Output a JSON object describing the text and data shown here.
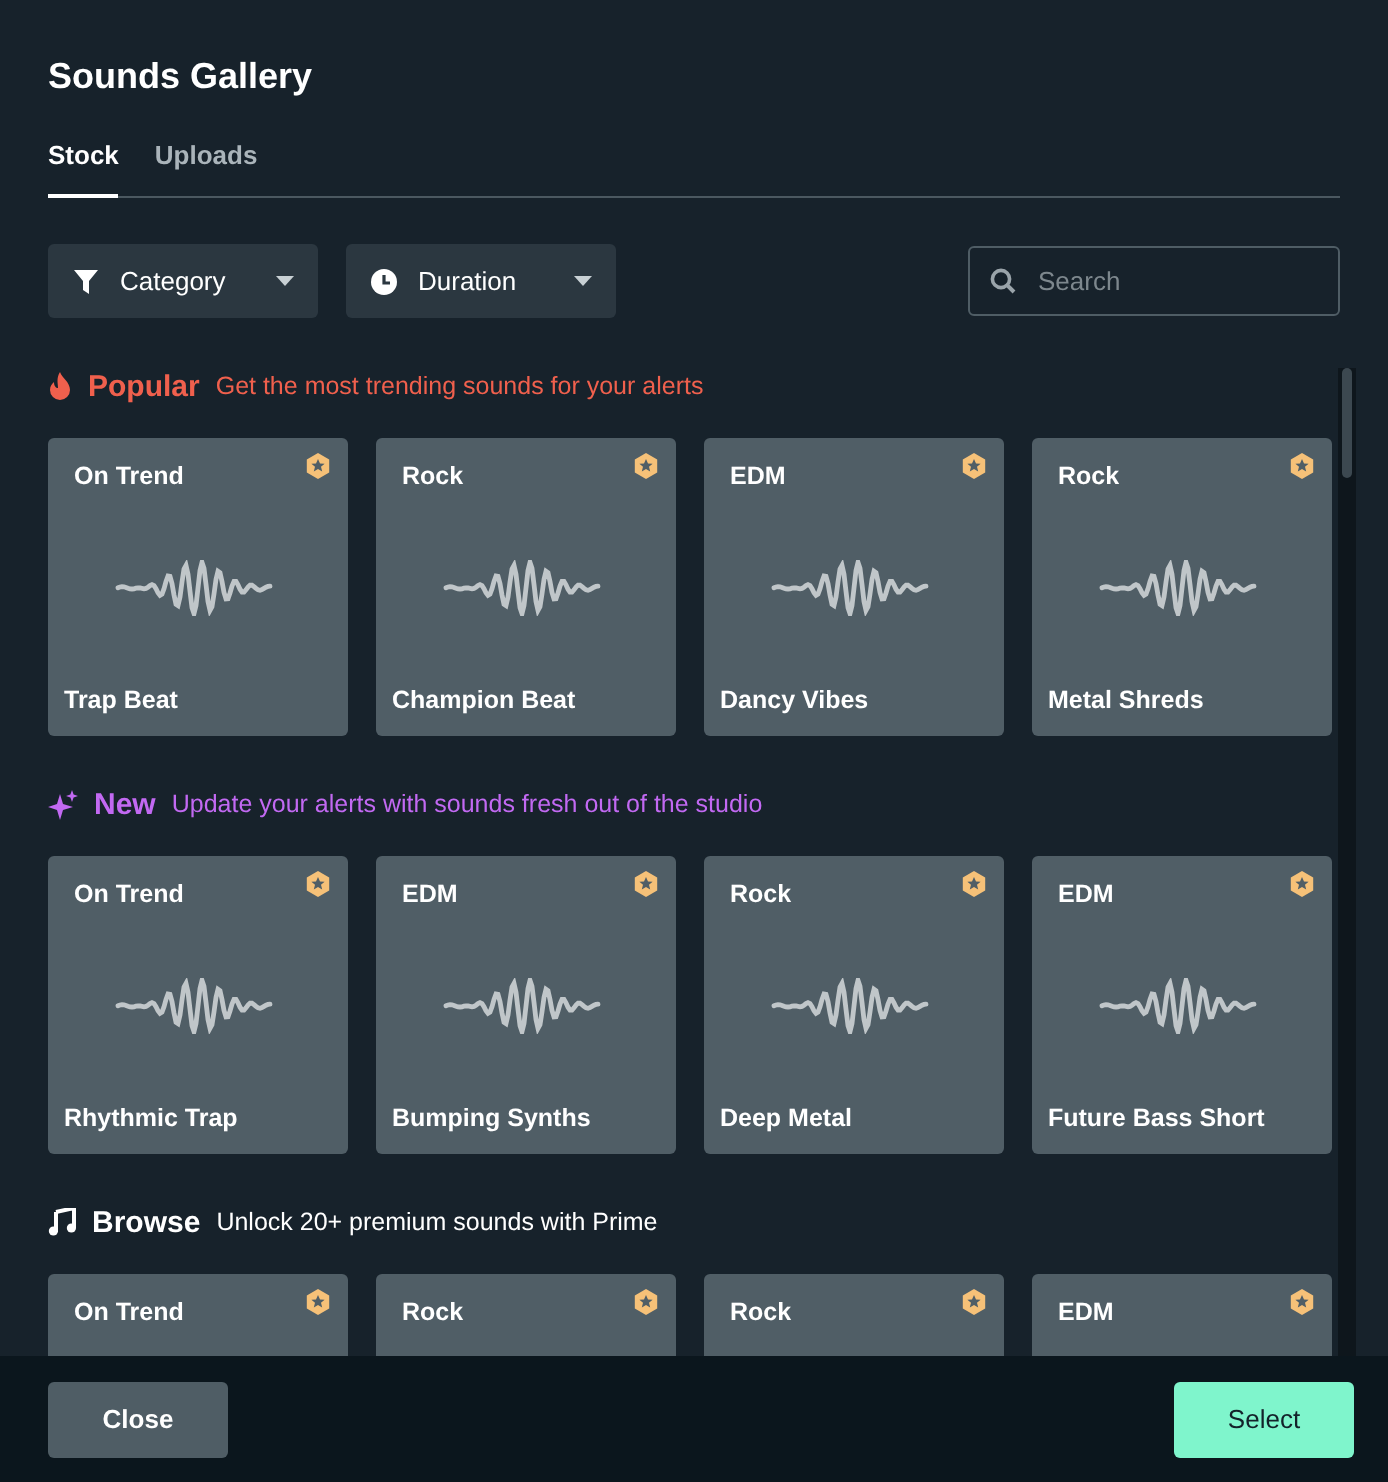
{
  "title": "Sounds Gallery",
  "tabs": [
    {
      "label": "Stock",
      "selected": true
    },
    {
      "label": "Uploads",
      "selected": false
    }
  ],
  "filters": [
    {
      "kind": "category",
      "label": "Category"
    },
    {
      "kind": "duration",
      "label": "Duration"
    }
  ],
  "search": {
    "placeholder": "Search"
  },
  "sections": [
    {
      "kind": "popular",
      "title": "Popular",
      "subtitle": "Get the most trending sounds for your alerts",
      "color": "#f0604d",
      "sounds": [
        {
          "tag": "On Trend",
          "name": "Trap Beat",
          "premium": true
        },
        {
          "tag": "Rock",
          "name": "Champion Beat",
          "premium": true
        },
        {
          "tag": "EDM",
          "name": "Dancy Vibes",
          "premium": true
        },
        {
          "tag": "Rock",
          "name": "Metal Shreds",
          "premium": true
        }
      ]
    },
    {
      "kind": "new",
      "title": "New",
      "subtitle": "Update your alerts with sounds fresh out of the studio",
      "color": "#c269f2",
      "sounds": [
        {
          "tag": "On Trend",
          "name": "Rhythmic Trap",
          "premium": true
        },
        {
          "tag": "EDM",
          "name": "Bumping Synths",
          "premium": true
        },
        {
          "tag": "Rock",
          "name": "Deep Metal",
          "premium": true
        },
        {
          "tag": "EDM",
          "name": "Future Bass Short",
          "premium": true
        }
      ]
    },
    {
      "kind": "browse",
      "title": "Browse",
      "subtitle": "Unlock 20+ premium sounds with Prime",
      "color": "#ffffff",
      "sounds": [
        {
          "tag": "On Trend",
          "premium": true
        },
        {
          "tag": "Rock",
          "premium": true
        },
        {
          "tag": "Rock",
          "premium": true
        },
        {
          "tag": "EDM",
          "premium": true
        }
      ]
    }
  ],
  "buttons": [
    {
      "kind": "secondary",
      "label": "Close"
    },
    {
      "kind": "primary",
      "label": "Select"
    }
  ]
}
